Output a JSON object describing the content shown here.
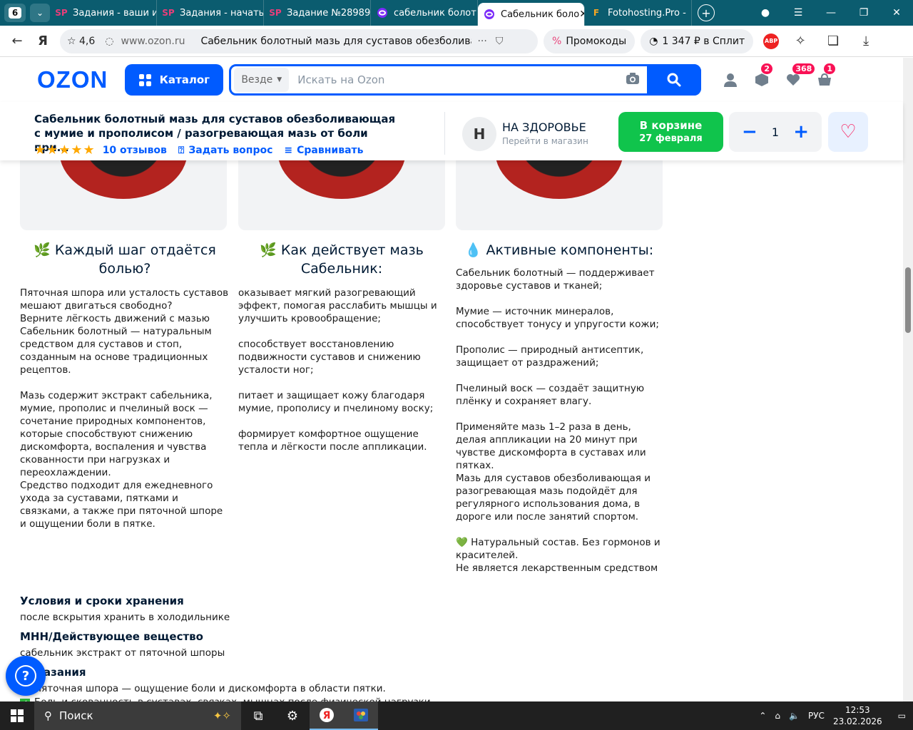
{
  "browser": {
    "tab_count": "6",
    "tabs": [
      {
        "label": "Задания - ваши и",
        "icon": "sp"
      },
      {
        "label": "Задания - начаты",
        "icon": "sp"
      },
      {
        "label": "Задание №28989",
        "icon": "sp"
      },
      {
        "label": "сабельник болот",
        "icon": "ozon"
      },
      {
        "label": "Сабельник боло",
        "icon": "ozon",
        "active": true
      },
      {
        "label": "Fotohosting.Pro -",
        "icon": "f"
      }
    ],
    "rating": "4,6",
    "domain": "www.ozon.ru",
    "page_title": "Сабельник болотный мазь для суставов обезболивающ...",
    "promo_label": "Промокоды",
    "split_label": "1 347 ₽ в Сплит",
    "abp_label": "ABP"
  },
  "header": {
    "logo": "OZON",
    "catalog_label": "Каталог",
    "scope_label": "Везде",
    "search_placeholder": "Искать на Ozon",
    "badges": {
      "orders": "2",
      "favorites": "368",
      "cart": "1"
    }
  },
  "product": {
    "title": "Сабельник болотный мазь для суставов обезболивающая с мумие и прополисом / разогревающая мазь от боли при...",
    "reviews": "10 отзывов",
    "ask": "Задать вопрос",
    "compare": "Сравнивать",
    "rating_stars": 5,
    "shop_initial": "Н",
    "shop_name": "НА ЗДОРОВЬЕ",
    "shop_sub": "Перейти в магазин",
    "cart_line1": "В корзине",
    "cart_line2": "27 февраля",
    "qty": "1"
  },
  "columns": [
    {
      "icon": "🌿",
      "title": "Каждый шаг отдаётся болью?",
      "text": "Пяточная шпора или усталость суставов мешают двигаться свободно?\nВерните лёгкость движений с мазью Сабельник болотный — натуральным средством для суставов и стоп, созданным на основе традиционных рецептов.\n\nМазь содержит экстракт сабельника, мумие, прополис и пчелиный воск — сочетание природных компонентов, которые способствуют снижению дискомфорта, воспаления и чувства скованности при нагрузках и переохлаждении.\nСредство подходит для ежедневного ухода за суставами, пятками и связками, а также при пяточной шпоре и ощущении боли в пятке."
    },
    {
      "icon": "🌿",
      "title": "Как действует мазь Сабельник:",
      "text": "оказывает мягкий разогревающий эффект, помогая расслабить мышцы и улучшить кровообращение;\n\nспособствует восстановлению подвижности суставов и снижению усталости ног;\n\nпитает и защищает кожу благодаря мумие, прополису и пчелиному воску;\n\nформирует комфортное ощущение тепла и лёгкости после аппликации."
    },
    {
      "icon": "💧",
      "title": "Активные компоненты:",
      "text": "Сабельник болотный — поддерживает здоровье суставов и тканей;\n\nМумие — источник минералов, способствует тонусу и упругости кожи;\n\nПрополис — природный антисептик, защищает от раздражений;\n\nПчелиный воск — создаёт защитную плёнку и сохраняет влагу.\n\nПрименяйте мазь 1–2 раза в день, делая аппликации на 20 минут при чувстве дискомфорта в суставах или пятках.\nМазь для суставов обезболивающая и разогревающая мазь подойдёт для регулярного использования дома, в дороге или после занятий спортом.\n\n💚 Натуральный состав. Без гормонов и красителей.\nНе является лекарственным средством"
    }
  ],
  "specs": [
    {
      "title": "Условия и сроки хранения",
      "value": "после вскрытия хранить в холодильнике"
    },
    {
      "title": "МНН/Действующее вещество",
      "value": "сабельник экстракт от пяточной шпоры"
    },
    {
      "title": "Показания",
      "value": ""
    }
  ],
  "indications": [
    "Пяточная шпора — ощущение боли и дискомфорта в области пятки.",
    "Боль и скованность в суставах, связках, мышцах после физической нагрузки."
  ],
  "taskbar": {
    "search_label": "Поиск",
    "lang": "РУС",
    "time": "12:53",
    "date": "23.02.2026"
  },
  "colors": {
    "brand": "#005bff",
    "cart_green": "#10c44c",
    "badge": "#f91155",
    "tabbar": "#0b5c6f"
  }
}
